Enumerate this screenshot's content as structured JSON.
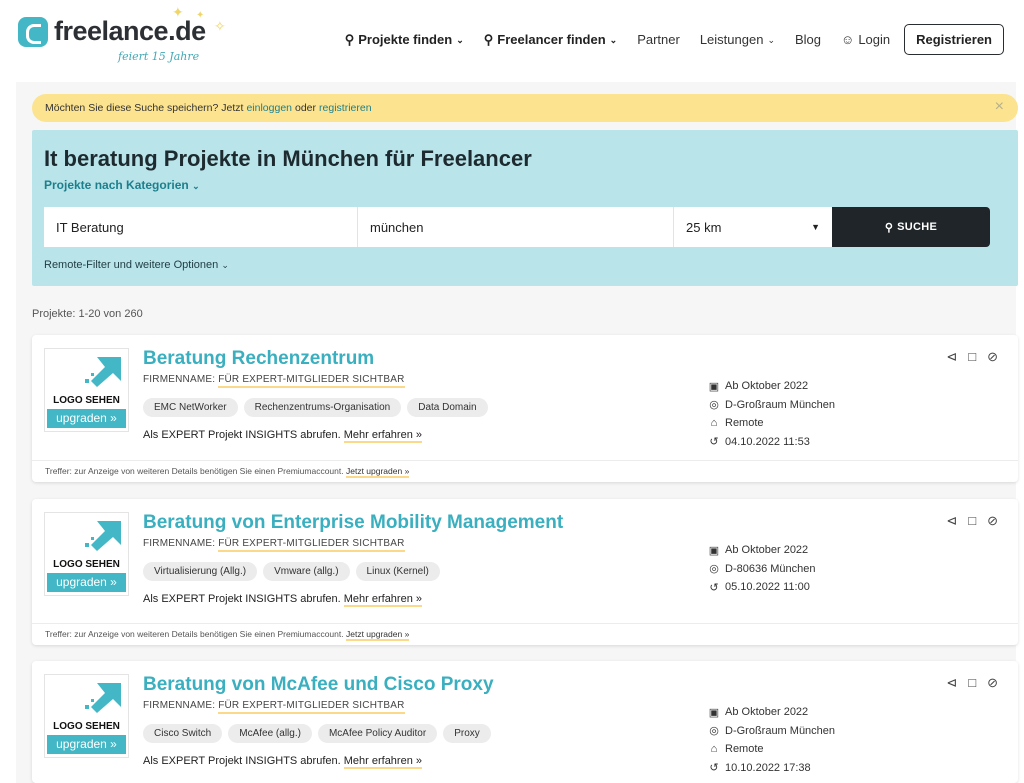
{
  "header": {
    "logo_text": "freelance.de",
    "logo_subtitle": "feiert 15 Jahre",
    "nav": {
      "projects": "Projekte finden",
      "freelancers": "Freelancer finden",
      "partner": "Partner",
      "services": "Leistungen",
      "blog": "Blog",
      "login": "Login",
      "register": "Registrieren"
    }
  },
  "banner": {
    "text_pre": "Möchten Sie diese Suche speichern? Jetzt",
    "login_link": "einloggen",
    "text_mid": "oder",
    "register_link": "registrieren",
    "close": "×"
  },
  "search": {
    "title": "It beratung Projekte in München für Freelancer",
    "categories_link": "Projekte nach Kategorien",
    "what_value": "IT Beratung",
    "where_value": "münchen",
    "radius_value": "25 km",
    "button_label": "SUCHE",
    "remote_filter": "Remote-Filter und weitere Optionen"
  },
  "results_count": "Projekte: 1-20 von 260",
  "common": {
    "logo_label": "LOGO SEHEN",
    "upgrade_label": "upgraden »",
    "firm_label": "FIRMENNAME:",
    "firm_value": "FÜR EXPERT-MITGLIEDER SICHTBAR",
    "expert_text": "Als EXPERT Projekt INSIGHTS abrufen.",
    "expert_more": "Mehr erfahren »",
    "footer_text": "Treffer: zur Anzeige von weiteren Details benötigen Sie einen Premiumaccount.",
    "footer_link": "Jetzt upgraden »"
  },
  "projects": [
    {
      "title": "Beratung Rechenzentrum",
      "tags": [
        "EMC NetWorker",
        "Rechenzentrums-Organisation",
        "Data Domain"
      ],
      "start": "Ab Oktober 2022",
      "location": "D-Großraum München",
      "remote": "Remote",
      "date": "04.10.2022 11:53"
    },
    {
      "title": "Beratung von Enterprise Mobility Management",
      "tags": [
        "Virtualisierung (Allg.)",
        "Vmware (allg.)",
        "Linux (Kernel)"
      ],
      "start": "Ab Oktober 2022",
      "location": "D-80636 München",
      "date": "05.10.2022 11:00"
    },
    {
      "title": "Beratung von McAfee und Cisco Proxy",
      "tags": [
        "Cisco Switch",
        "McAfee (allg.)",
        "McAfee Policy Auditor",
        "Proxy"
      ],
      "start": "Ab Oktober 2022",
      "location": "D-Großraum München",
      "remote": "Remote",
      "date": "10.10.2022 17:38"
    }
  ],
  "colors": {
    "brand": "#43b7c5",
    "banner": "#fce38f",
    "search_panel": "#b9e5ea",
    "dark": "#1f2528"
  }
}
